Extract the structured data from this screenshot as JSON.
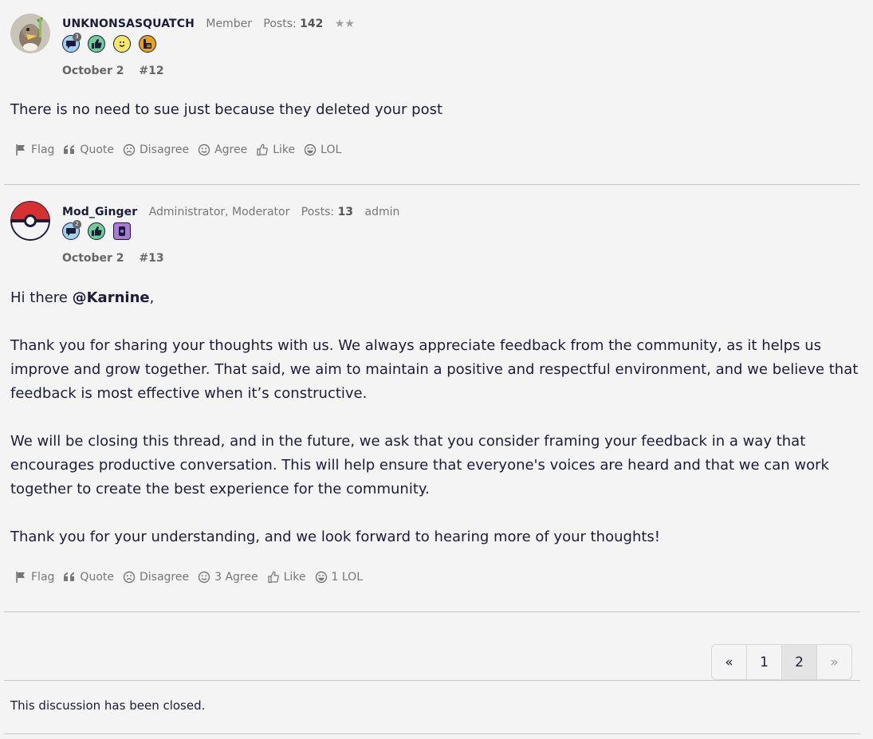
{
  "posts": [
    {
      "author": "UNKNONSASQUATCH",
      "role": "Member",
      "posts_label": "Posts:",
      "posts_count": "142",
      "rank": "★★",
      "badges": [
        {
          "icon": "comment-icon",
          "count": "3",
          "color": "#9fd0ef"
        },
        {
          "icon": "thumbs-up-icon",
          "color": "#6fcf97"
        },
        {
          "icon": "smiley-icon",
          "color": "#f5e56b"
        },
        {
          "icon": "hand-icon",
          "color": "#e9a21b"
        }
      ],
      "date": "October 2",
      "number": "#12",
      "body": [
        "There is no need to sue just because they deleted your post"
      ],
      "reactions": {
        "flag": "Flag",
        "quote": "Quote",
        "disagree": "Disagree",
        "agree": "Agree",
        "like": "Like",
        "lol": "LOL"
      }
    },
    {
      "author": "Mod_Ginger",
      "role": "Administrator, Moderator",
      "posts_label": "Posts:",
      "posts_count": "13",
      "rank": "admin",
      "badges": [
        {
          "icon": "comment-icon",
          "count": "2",
          "color": "#9fd0ef"
        },
        {
          "icon": "thumbs-up-icon",
          "color": "#6fcf97"
        },
        {
          "icon": "phone-icon",
          "color": "#a77bd6"
        }
      ],
      "date": "October 2",
      "number": "#13",
      "greeting_prefix": "Hi there ",
      "mention": "@Karnine",
      "greeting_suffix": ",",
      "paragraphs": [
        "Thank you for sharing your thoughts with us. We always appreciate feedback from the community, as it helps us improve and grow together. That said, we aim to maintain a positive and respectful environment, and we believe that feedback is most effective when it’s constructive.",
        "We will be closing this thread, and in the future, we ask that you consider framing your feedback in a way that encourages productive conversation. This will help ensure that everyone's voices are heard and that we can work together to create the best experience for the community.",
        "Thank you for your understanding, and we look forward to hearing more of your thoughts!"
      ],
      "reactions": {
        "flag": "Flag",
        "quote": "Quote",
        "disagree": "Disagree",
        "agree": "3 Agree",
        "like": "Like",
        "lol": "1 LOL"
      }
    }
  ],
  "pagination": {
    "prev": "«",
    "pages": [
      "1",
      "2"
    ],
    "current": "2",
    "next": "»"
  },
  "closed_note": "This discussion has been closed."
}
